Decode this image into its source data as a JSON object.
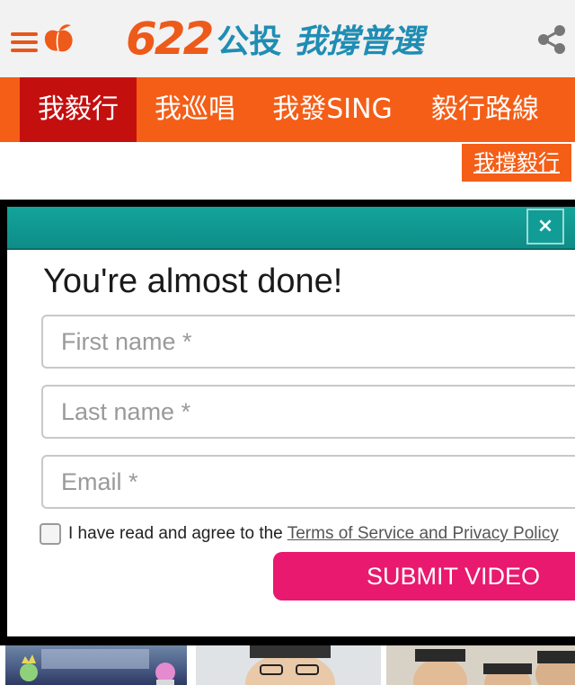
{
  "header": {
    "logo_number": "622",
    "logo_part1": "公投",
    "logo_part2": "我撐普選",
    "icons": [
      "menu-icon",
      "peach-icon",
      "share-icon"
    ],
    "colors": {
      "brand_orange": "#ee5a1a",
      "brand_blue": "#1f8db4"
    }
  },
  "nav": {
    "items": [
      {
        "label": "我毅行",
        "active": true
      },
      {
        "label": "我巡唱",
        "active": false
      },
      {
        "label": "我發SING",
        "active": false
      },
      {
        "label": "毅行路線",
        "active": false
      }
    ],
    "colors": {
      "background": "#f45e17",
      "active": "#c40f0f"
    }
  },
  "support_button": {
    "label": "我撐毅行"
  },
  "modal": {
    "title": "You're almost done!",
    "fields": {
      "first_name": {
        "placeholder": "First name *",
        "value": ""
      },
      "last_name": {
        "placeholder": "Last name *",
        "value": ""
      },
      "email": {
        "placeholder": "Email *",
        "value": ""
      }
    },
    "agree_text": "I have read and agree to the",
    "terms_link": "Terms of Service and Privacy Policy",
    "agree_checked": false,
    "submit_label": "SUBMIT VIDEO",
    "close_label": "×",
    "colors": {
      "bar": "#13a49b",
      "submit": "#e8196e"
    }
  },
  "thumbnails": [
    "video-thumbnail-1",
    "video-thumbnail-2",
    "video-thumbnail-3"
  ]
}
